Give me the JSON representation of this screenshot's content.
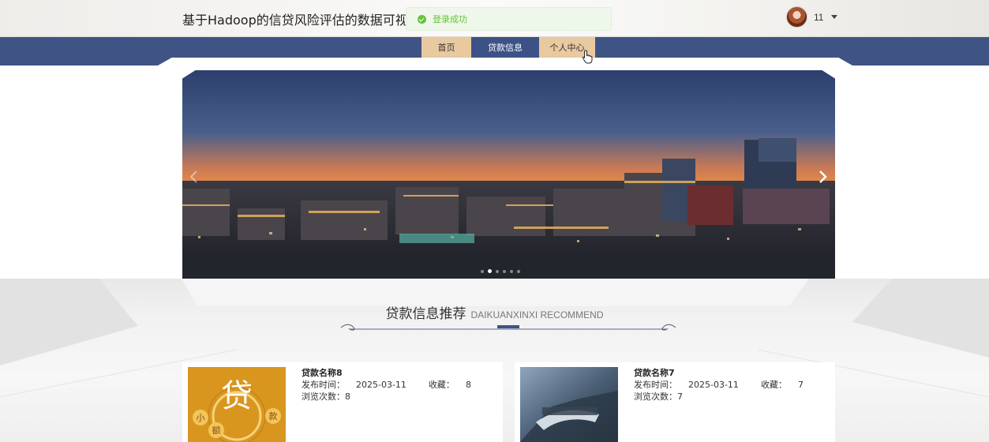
{
  "header": {
    "site_title": "基于Hadoop的信贷风险评估的数据可视化",
    "toast": "登录成功",
    "username": "11"
  },
  "nav": {
    "home": "首页",
    "loan_info": "贷款信息",
    "profile": "个人中心"
  },
  "section": {
    "title_cn": "贷款信息推荐",
    "title_en": "DAIKUANXINXI RECOMMEND"
  },
  "cards": [
    {
      "name": "贷款名称8",
      "publish_label": "发布时间：",
      "publish_date": "2025-03-11",
      "fav_label": "收藏：",
      "fav_count": "8",
      "views_label": "浏览次数：",
      "views": "8",
      "image_text_1": "小",
      "image_text_2": "额",
      "image_text_3": "款",
      "image_text_big": "贷"
    },
    {
      "name": "贷款名称7",
      "publish_label": "发布时间：",
      "publish_date": "2025-03-11",
      "fav_label": "收藏：",
      "fav_count": "7",
      "views_label": "浏览次数：",
      "views": "7"
    }
  ],
  "colors": {
    "nav_band": "#3f5485",
    "nav_tab": "#e8c9a0",
    "nav_active": "#3c5286",
    "toast_green": "#67c23a"
  }
}
